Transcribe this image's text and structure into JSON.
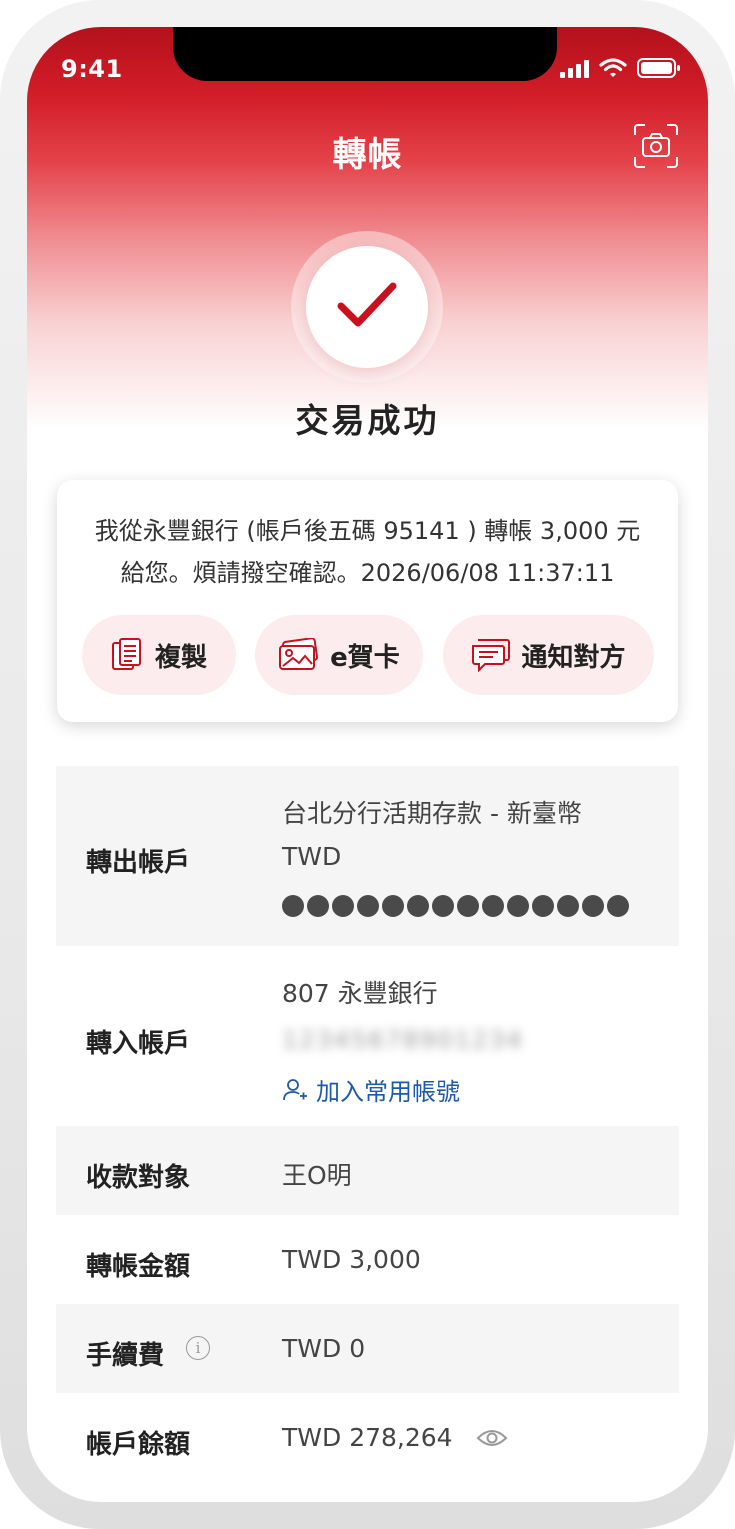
{
  "status_bar": {
    "time": "9:41"
  },
  "header": {
    "title": "轉帳"
  },
  "result": {
    "title": "交易成功"
  },
  "message": {
    "line1": "我從永豐銀行 (帳戶後五碼 95141 ) 轉帳 3,000 元",
    "line2": "給您。煩請撥空確認。2026/06/08 11:37:11"
  },
  "actions": {
    "copy_label": "複製",
    "ecard_label": "e賀卡",
    "notify_label": "通知對方"
  },
  "details": {
    "from_account": {
      "label": "轉出帳戶",
      "name": "台北分行活期存款 - 新臺幣",
      "currency": "TWD",
      "masked_digit_count": 14
    },
    "to_account": {
      "label": "轉入帳戶",
      "bank": "807 永豐銀行",
      "account_number": "12345678901234",
      "add_favorite_label": "加入常用帳號"
    },
    "payee": {
      "label": "收款對象",
      "value": "王O明"
    },
    "amount": {
      "label": "轉帳金額",
      "value": "TWD 3,000"
    },
    "fee": {
      "label": "手續費",
      "value": "TWD 0"
    },
    "balance": {
      "label": "帳戶餘額",
      "value": "TWD 278,264"
    }
  },
  "colors": {
    "brand_red": "#c8101e",
    "link_blue": "#1e5aa8",
    "action_bg": "#fdeced"
  }
}
